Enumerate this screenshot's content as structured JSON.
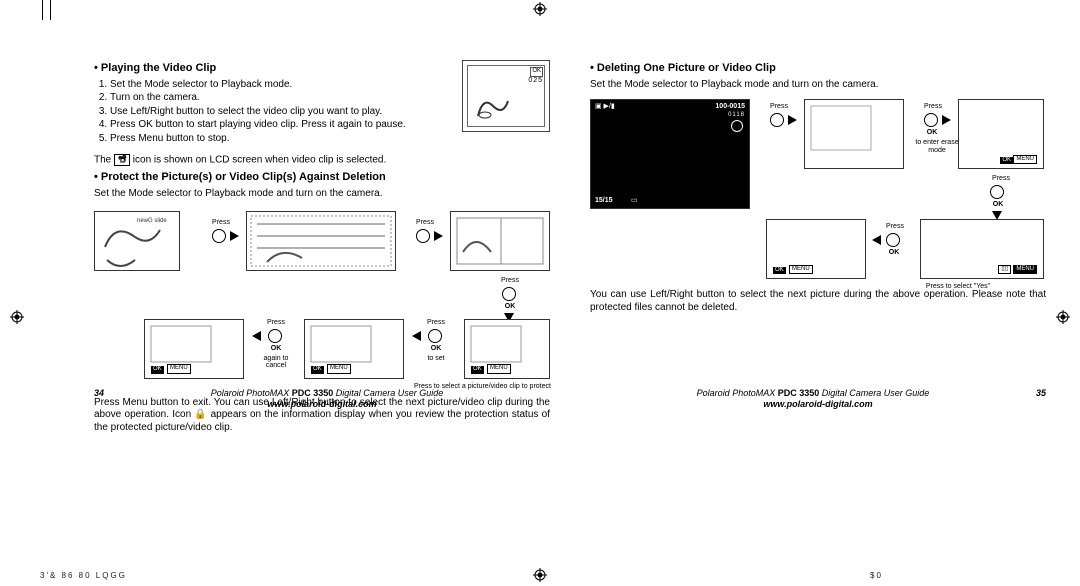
{
  "left": {
    "heading_play": "Playing the Video Clip",
    "steps_play": [
      "Set the Mode selector to Playback mode.",
      "Turn on the camera.",
      "Use Left/Right button to select the video clip you want to play.",
      "Press OK button to start playing video clip. Press it again to pause.",
      "Press Menu button to stop."
    ],
    "note_icon_pre": "The ",
    "note_icon_post": " icon is shown on LCD screen when video clip is selected.",
    "heading_protect": "Protect the Picture(s) or Video Clip(s) Against Deletion",
    "line_protect": "Set the Mode selector to Playback mode and turn on the camera.",
    "press": "Press",
    "ok": "OK",
    "menu": "MENU",
    "again_to_cancel": "again to\ncancel",
    "to_set": "to set",
    "caption_select": "Press        to   select   a picture/video clip to protect",
    "para_exit": "Press Menu button to exit. You can use Left/Right button to select the next picture/video clip during the above operation. Icon  🔒  appears on the information display when you review the protection status of the protected picture/video clip.",
    "page_no": "34"
  },
  "right": {
    "heading_delete": "Deleting One Picture or Video Clip",
    "line_delete": "Set the Mode selector to Playback mode and turn on the camera.",
    "press": "Press",
    "ok": "OK",
    "menu": "MENU",
    "to_enter_erase": "to enter erase\nmode",
    "caption_yes": "Press      to select \"Yes\"",
    "para_note": "You can use Left/Right button to select the next picture during the above operation. Please note that protected files cannot be deleted.",
    "lcd_folder": "100-0015",
    "lcd_count": "15/15",
    "lcd_time": "0118",
    "page_no": "35"
  },
  "footer": {
    "line1_a": "Polaroid PhotoMAX ",
    "line1_b": "PDC 3350",
    "line1_c": " Digital Camera User Guide",
    "line2": "www.polaroid-digital.com"
  },
  "bottom": {
    "left_code": "3'&       86 80  LQGG",
    "right_code": "$0"
  }
}
